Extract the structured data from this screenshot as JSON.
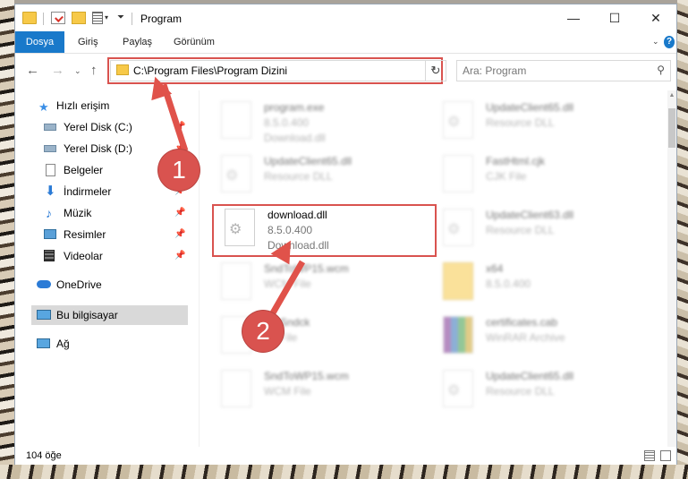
{
  "window": {
    "title": "Program",
    "controls": {
      "minimize": "—",
      "maximize": "☐",
      "close": "✕"
    }
  },
  "ribbon": {
    "tabs": [
      "Dosya",
      "Giriş",
      "Paylaş",
      "Görünüm"
    ],
    "help": "?"
  },
  "address": {
    "path": "C:\\Program Files\\Program Dizini",
    "search_placeholder": "Ara: Program"
  },
  "sidebar": {
    "items": [
      {
        "label": "Hızlı erişim",
        "icon": "star-icon"
      },
      {
        "label": "Yerel Disk (C:)",
        "icon": "drive-icon",
        "pinned": true
      },
      {
        "label": "Yerel Disk (D:)",
        "icon": "drive-icon",
        "pinned": true
      },
      {
        "label": "Belgeler",
        "icon": "document-icon",
        "pinned": true
      },
      {
        "label": "İndirmeler",
        "icon": "download-icon",
        "pinned": true
      },
      {
        "label": "Müzik",
        "icon": "music-icon",
        "pinned": true
      },
      {
        "label": "Resimler",
        "icon": "pictures-icon",
        "pinned": true
      },
      {
        "label": "Videolar",
        "icon": "video-icon",
        "pinned": true
      },
      {
        "label": "OneDrive",
        "icon": "cloud-icon"
      },
      {
        "label": "Bu bilgisayar",
        "icon": "computer-icon",
        "selected": true
      },
      {
        "label": "Ağ",
        "icon": "network-icon"
      }
    ]
  },
  "files": [
    {
      "name": "program.exe",
      "line1": "8.5.0.400",
      "line2": "Download.dll"
    },
    {
      "name": "UpdateClient65.dll",
      "line1": "Resource DLL",
      "line2": ""
    },
    {
      "name": "UpdateClient65.dll",
      "line1": "Resource DLL",
      "line2": ""
    },
    {
      "name": "FastHtml.cjk",
      "line1": "CJK File",
      "line2": ""
    },
    {
      "name": "download.dll",
      "line1": "8.5.0.400",
      "line2": "Download.dll"
    },
    {
      "name": "UpdateClient63.dll",
      "line1": "Resource DLL",
      "line2": ""
    },
    {
      "name": "SndToWP15.wcm",
      "line1": "WCM File",
      "line2": ""
    },
    {
      "name": "x64",
      "line1": "8.5.0.400",
      "line2": ""
    },
    {
      "name": "Sndck",
      "line1": "File",
      "line2": ""
    },
    {
      "name": "certificates.cab",
      "line1": "WinRAR Archive",
      "line2": ""
    },
    {
      "name": "SndToWP15.wcm",
      "line1": "WCM File",
      "line2": ""
    },
    {
      "name": "UpdateClient65.dll",
      "line1": "Resource DLL",
      "line2": ""
    }
  ],
  "status": {
    "item_count": "104 öğe"
  },
  "annotations": {
    "step1": "1",
    "step2": "2"
  },
  "colors": {
    "accent": "#1979ca",
    "highlight": "#d9534f"
  }
}
